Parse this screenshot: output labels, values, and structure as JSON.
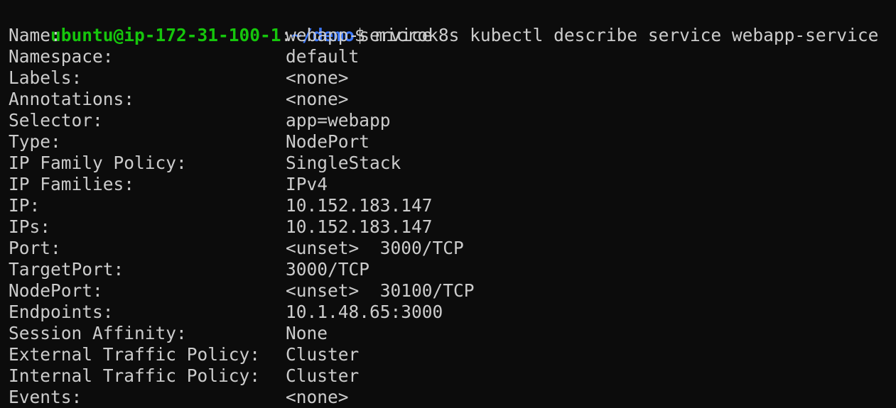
{
  "window": {
    "background": "#0c0c0c",
    "foreground": "#cccccc"
  },
  "prompt": {
    "user_host": "ubuntu@ip-172-31-100-1",
    "separator": ":",
    "path": "~/demo",
    "symbol": "$",
    "command": " microk8s kubectl describe service webapp-service",
    "user_color": "#16c60c",
    "path_color": "#3b78ff"
  },
  "output": [
    {
      "label": "Name:",
      "value": "webapp-service"
    },
    {
      "label": "Namespace:",
      "value": "default"
    },
    {
      "label": "Labels:",
      "value": "<none>"
    },
    {
      "label": "Annotations:",
      "value": "<none>"
    },
    {
      "label": "Selector:",
      "value": "app=webapp"
    },
    {
      "label": "Type:",
      "value": "NodePort"
    },
    {
      "label": "IP Family Policy:",
      "value": "SingleStack"
    },
    {
      "label": "IP Families:",
      "value": "IPv4"
    },
    {
      "label": "IP:",
      "value": "10.152.183.147"
    },
    {
      "label": "IPs:",
      "value": "10.152.183.147"
    },
    {
      "label": "Port:",
      "value": "<unset>  3000/TCP"
    },
    {
      "label": "TargetPort:",
      "value": "3000/TCP"
    },
    {
      "label": "NodePort:",
      "value": "<unset>  30100/TCP"
    },
    {
      "label": "Endpoints:",
      "value": "10.1.48.65:3000"
    },
    {
      "label": "Session Affinity:",
      "value": "None"
    },
    {
      "label": "External Traffic Policy:",
      "value": "Cluster"
    },
    {
      "label": "Internal Traffic Policy:",
      "value": "Cluster"
    },
    {
      "label": "Events:",
      "value": "<none>"
    }
  ]
}
